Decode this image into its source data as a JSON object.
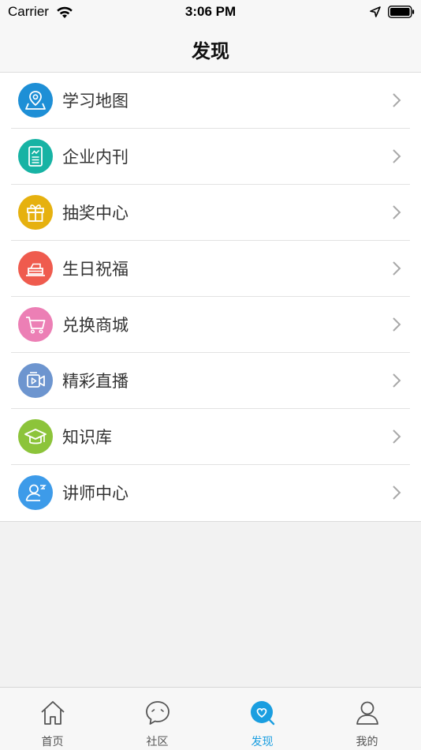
{
  "status_bar": {
    "carrier": "Carrier",
    "time": "3:06 PM"
  },
  "nav": {
    "title": "发现"
  },
  "list": {
    "items": [
      {
        "label": "学习地图",
        "icon": "map-pin-icon",
        "color": "#1e8fd6"
      },
      {
        "label": "企业内刊",
        "icon": "magazine-icon",
        "color": "#17b3a4"
      },
      {
        "label": "抽奖中心",
        "icon": "gift-icon",
        "color": "#e6b10f"
      },
      {
        "label": "生日祝福",
        "icon": "cake-icon",
        "color": "#ef5b4e"
      },
      {
        "label": "兑换商城",
        "icon": "cart-icon",
        "color": "#ec7fb5"
      },
      {
        "label": "精彩直播",
        "icon": "video-icon",
        "color": "#6d95cf"
      },
      {
        "label": "知识库",
        "icon": "graduation-cap-icon",
        "color": "#8cc43a"
      },
      {
        "label": "讲师中心",
        "icon": "lecturer-icon",
        "color": "#3d9be9"
      }
    ]
  },
  "tab_bar": {
    "tabs": [
      {
        "label": "首页",
        "icon": "home-icon",
        "active": false
      },
      {
        "label": "社区",
        "icon": "chat-bubble-icon",
        "active": false
      },
      {
        "label": "发现",
        "icon": "discover-heart-icon",
        "active": true
      },
      {
        "label": "我的",
        "icon": "person-icon",
        "active": false
      }
    ],
    "active_color": "#1a9ee0"
  }
}
